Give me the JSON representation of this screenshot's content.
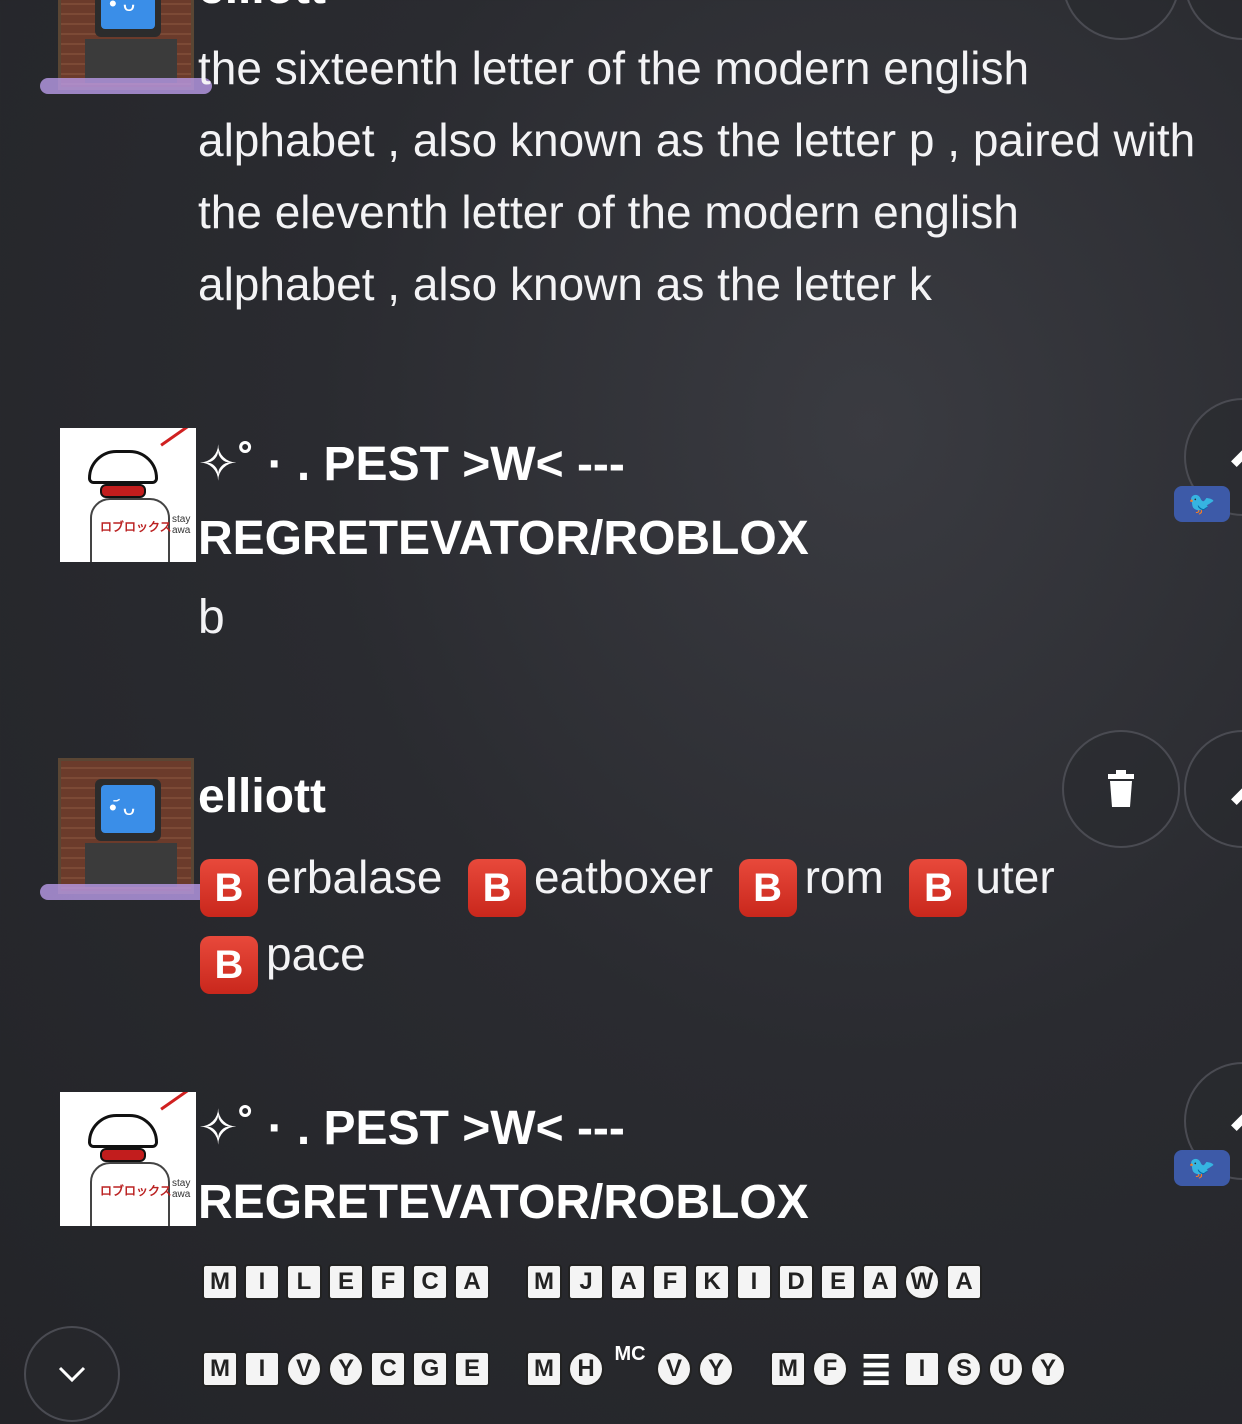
{
  "messages": [
    {
      "username": "elliott",
      "text": "the sixteenth letter of the modern english alphabet , also known as the letter p , paired with the eleventh letter of the modern english alphabet , also known as the letter k"
    },
    {
      "username": "✧˚ · . PEST >W< --- REGRETEVATOR/ROBLOX",
      "text": "b"
    },
    {
      "username": "elliott",
      "b_words": [
        "erbalase",
        "eatboxer",
        "rom",
        "uter",
        "pace"
      ],
      "b_label": "B"
    },
    {
      "username": "✧˚ · . PEST >W< --- REGRETEVATOR/ROBLOX",
      "line1": [
        [
          "M",
          "I",
          "L",
          "E",
          "F",
          "C",
          "A"
        ],
        [
          "M",
          "J",
          "A",
          "F",
          "K",
          "I",
          "D",
          "E",
          "A",
          "W",
          "A"
        ]
      ],
      "line2_groups": [
        [
          "M",
          "I",
          "V",
          "Y",
          "C",
          "G",
          "E"
        ],
        [
          "M",
          "H",
          "MC",
          "V",
          "Y"
        ],
        [
          "M",
          "F",
          "≣",
          "I",
          "S",
          "U",
          "Y"
        ]
      ]
    }
  ],
  "icons": {
    "trash": "trash-icon",
    "edit": "pencil-icon",
    "scroll_down": "chevron-down-icon"
  },
  "avatar_text": {
    "sketch_tag": "ロブロックス",
    "sketch_note": "stay awa"
  }
}
